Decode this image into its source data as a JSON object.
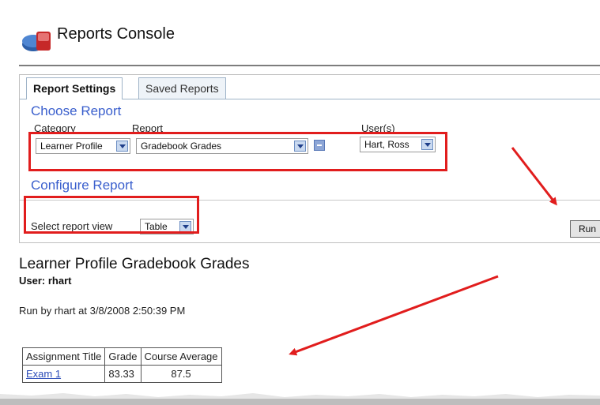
{
  "console": {
    "title": "Reports Console",
    "icon": "reports-console-icon"
  },
  "tabs": [
    {
      "label": "Report Settings",
      "active": true
    },
    {
      "label": "Saved Reports",
      "active": false
    }
  ],
  "choose_report": {
    "heading": "Choose Report",
    "category": {
      "label": "Category",
      "value": "Learner Profile"
    },
    "report": {
      "label": "Report",
      "value": "Gradebook Grades"
    },
    "users": {
      "label": "User(s)",
      "value": "Hart, Ross"
    }
  },
  "configure_report": {
    "heading": "Configure Report",
    "view_label": "Select report view",
    "view_value": "Table"
  },
  "run_button": {
    "label": "Run"
  },
  "report": {
    "title": "Learner Profile Gradebook Grades",
    "user_line": "User: rhart",
    "run_by": "Run by rhart at 3/8/2008 2:50:39 PM",
    "table": {
      "headers": [
        "Assignment Title",
        "Grade",
        "Course Average"
      ],
      "rows": [
        {
          "assignment": "Exam 1",
          "grade": "83.33",
          "average": "87.5"
        }
      ]
    }
  },
  "annotation_color": "#e11d1d"
}
